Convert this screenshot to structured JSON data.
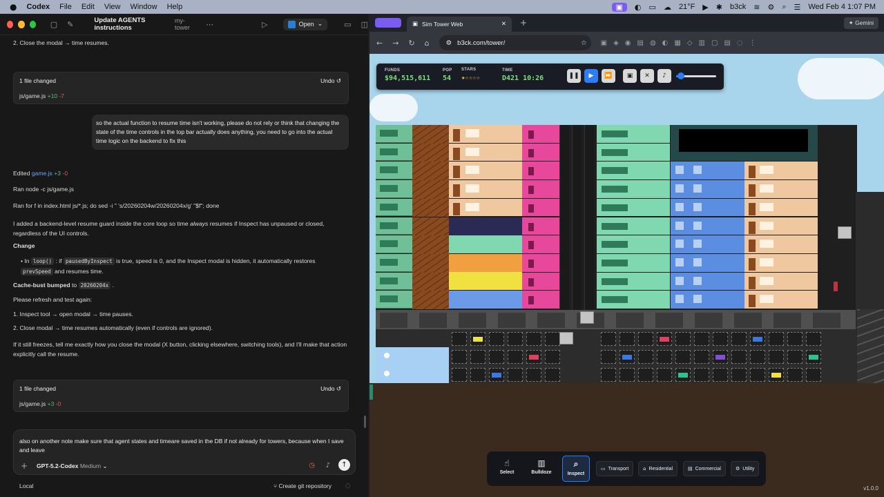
{
  "menubar": {
    "apple": "",
    "app": "Codex",
    "menus": [
      "File",
      "Edit",
      "View",
      "Window",
      "Help"
    ],
    "weather": "21°F",
    "user": "b3ck",
    "datetime": "Wed Feb 4  1:07 PM"
  },
  "codex": {
    "title": "Update AGENTS instructions",
    "project": "my-tower",
    "open_label": "Open",
    "top_line": "2. Close the modal → time resumes.",
    "card1": {
      "header": "1 file changed",
      "undo": "Undo",
      "file": "js/game.js",
      "plus": "+10",
      "minus": "-7"
    },
    "user_msg": "so the actual function to resume time isn't working, please do not rely or think that changing the state of the time controls in the top bar actually does anything, you need to go into the actual time logic on the backend to fix this",
    "edited_prefix": "Edited",
    "edited_file": "game.js",
    "edited_plus": "+3",
    "edited_minus": "-0",
    "ran1": "Ran node -c js/game.js",
    "ran2": "Ran for f in index.html js/*.js; do sed -i '' 's/20260204w/20260204x/g' \"$f\"; done",
    "para1a": "I added a backend-level resume guard inside the core loop so time ",
    "para1b": "always",
    "para1c": " resumes if Inspect has unpaused or closed, regardless of the UI controls.",
    "change_heading": "Change",
    "bullet_in": "In ",
    "bullet_code1": "loop()",
    "bullet_t2": " : if ",
    "bullet_code2": "pausedByInspect",
    "bullet_t3": " is true, speed is 0, and the Inspect modal is hidden, it automatically restores ",
    "bullet_code3": "prevSpeed",
    "bullet_t4": " and resumes time.",
    "cache_bold": "Cache-bust bumped",
    "cache_to": " to ",
    "cache_code": "20260204x",
    "cache_end": " .",
    "refresh": "Please refresh and test again:",
    "step1": "1. Inspect tool → open modal → time pauses.",
    "step2": "2. Close modal → time resumes automatically (even if controls are ignored).",
    "freeze_note": "If it still freezes, tell me exactly how you close the modal (X button, clicking elsewhere, switching tools), and I'll make that action explicitly call the resume.",
    "card2": {
      "header": "1 file changed",
      "undo": "Undo",
      "file": "js/game.js",
      "plus": "+3",
      "minus": "-0"
    },
    "composer_text": "also on another note make sure that agent states and timeare saved in the DB if not already for towers, because when I save and leave",
    "model": "GPT-5.2-Codex",
    "effort": "Medium",
    "footer_left": "Local",
    "footer_right": "Create git repository"
  },
  "browser": {
    "tab_title": "Sim Tower Web",
    "url": "b3ck.com/tower/",
    "gemini": "Gemini"
  },
  "hud": {
    "funds_label": "FUNDS",
    "funds": "$94,515,611",
    "pop_label": "POP",
    "pop": "54",
    "stars_label": "STARS",
    "stars": "★☆☆☆☆",
    "time_label": "TIME",
    "time": "D421 10:26",
    "volume": 0.12
  },
  "tools": {
    "select": "Select",
    "bulldoze": "Bulldoze",
    "inspect": "Inspect",
    "transport": "Transport",
    "residential": "Residential",
    "commercial": "Commercial",
    "utility": "Utility"
  },
  "version": "v1.0.0"
}
